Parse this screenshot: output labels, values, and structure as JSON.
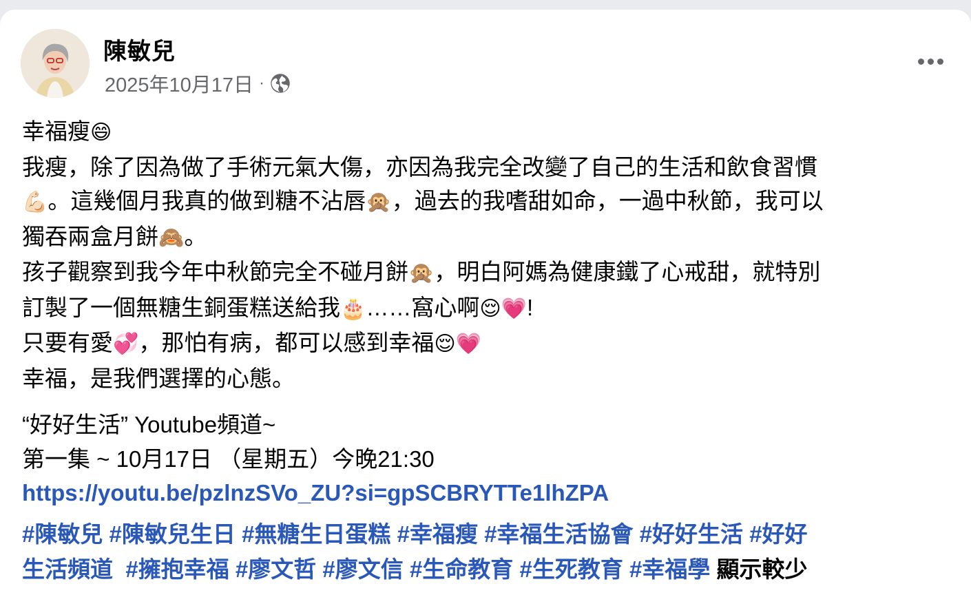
{
  "post": {
    "author": "陳敏兒",
    "date": "2025年10月17日",
    "separator": "·",
    "privacy_icon": "globe-icon",
    "lines": [
      [
        "幸福瘦",
        "😄"
      ],
      [
        "我瘦，除了因為做了手術元氣大傷，亦因為我完全改變了自己的生活和飲食習慣"
      ],
      [
        "💪🏻",
        "。這幾個月我真的做到糖不沾唇",
        "🙊",
        "，過去的我嗜甜如命，一過中秋節，我可以"
      ],
      [
        "獨吞兩盒月餅",
        "🙈",
        "。"
      ],
      [
        "孩子觀察到我今年中秋節完全不碰月餅",
        "🙊",
        "，明白阿媽為健康鐵了心戒甜，就特別"
      ],
      [
        "訂製了一個無糖生銅蛋糕送給我",
        "🎂",
        "……窩心啊",
        "😌",
        "💗",
        "!"
      ],
      [
        "只要有愛",
        "💞",
        "，那怕有病，都可以感到幸福",
        "😌",
        "💗"
      ],
      [
        "幸福，是我們選擇的心態。"
      ]
    ],
    "youtube_line": "“好好生活” Youtube頻道~",
    "episode_line": "第一集 ~ 10月17日 （星期五）今晚21:30",
    "link": "https://youtu.be/pzlnzSVo_ZU?si=gpSCBRYTTe1lhZPA",
    "hashtags_line1": [
      "#陳敏兒",
      "#陳敏兒生日",
      "#無糖生日蛋糕",
      "#幸福瘦",
      "#幸福生活協會",
      "#好好生活",
      "#好好"
    ],
    "hashtags_line2": [
      "生活頻道",
      "#擁抱幸福",
      "#廖文哲",
      "#廖文信",
      "#生命教育",
      "#生死教育",
      "#幸福學"
    ],
    "show_less": "顯示較少"
  },
  "colors": {
    "link": "#2a58b8",
    "meta": "#65676b",
    "text": "#050505"
  }
}
